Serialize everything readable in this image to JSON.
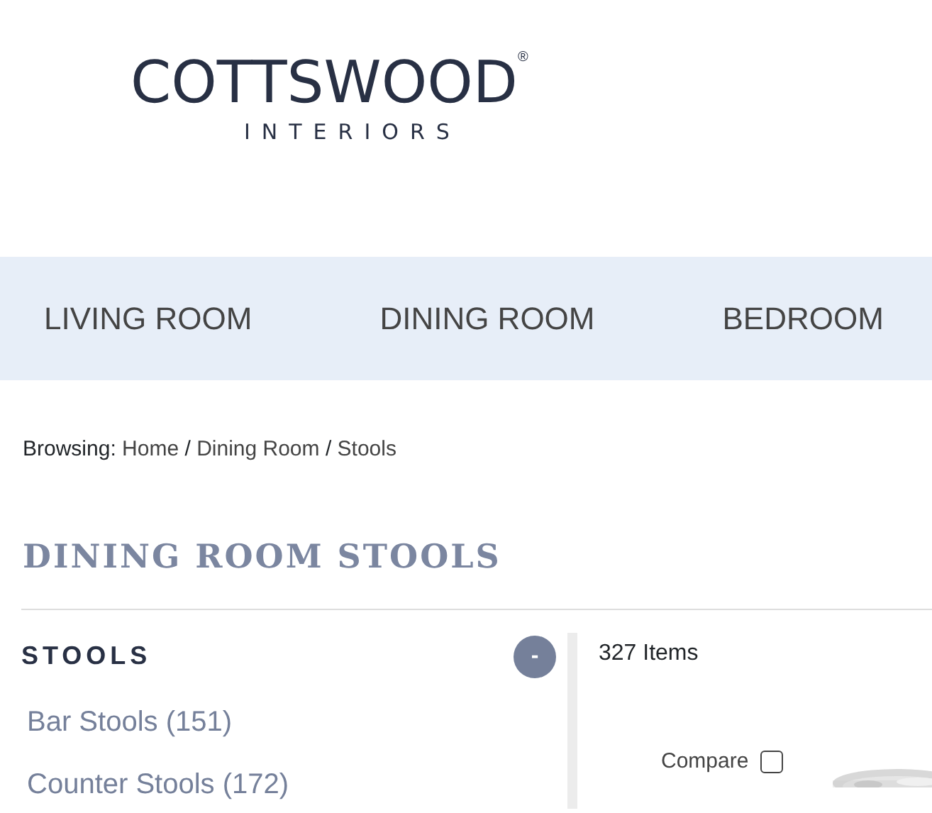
{
  "logo": {
    "name": "COTTSWOOD",
    "mark": "®",
    "tagline": "INTERIORS"
  },
  "nav": [
    {
      "label": "LIVING ROOM"
    },
    {
      "label": "DINING ROOM"
    },
    {
      "label": "BEDROOM"
    }
  ],
  "breadcrumb": {
    "prefix": "Browsing:",
    "items": [
      "Home",
      "Dining Room",
      "Stools"
    ],
    "separator": "/"
  },
  "page_title": "DINING ROOM STOOLS",
  "sidebar": {
    "title": "STOOLS",
    "toggle": "-",
    "items": [
      {
        "label": "Bar Stools (151)"
      },
      {
        "label": "Counter Stools (172)"
      }
    ]
  },
  "results": {
    "count": "327 Items",
    "compare": {
      "label": "Compare",
      "checked": false
    }
  }
}
